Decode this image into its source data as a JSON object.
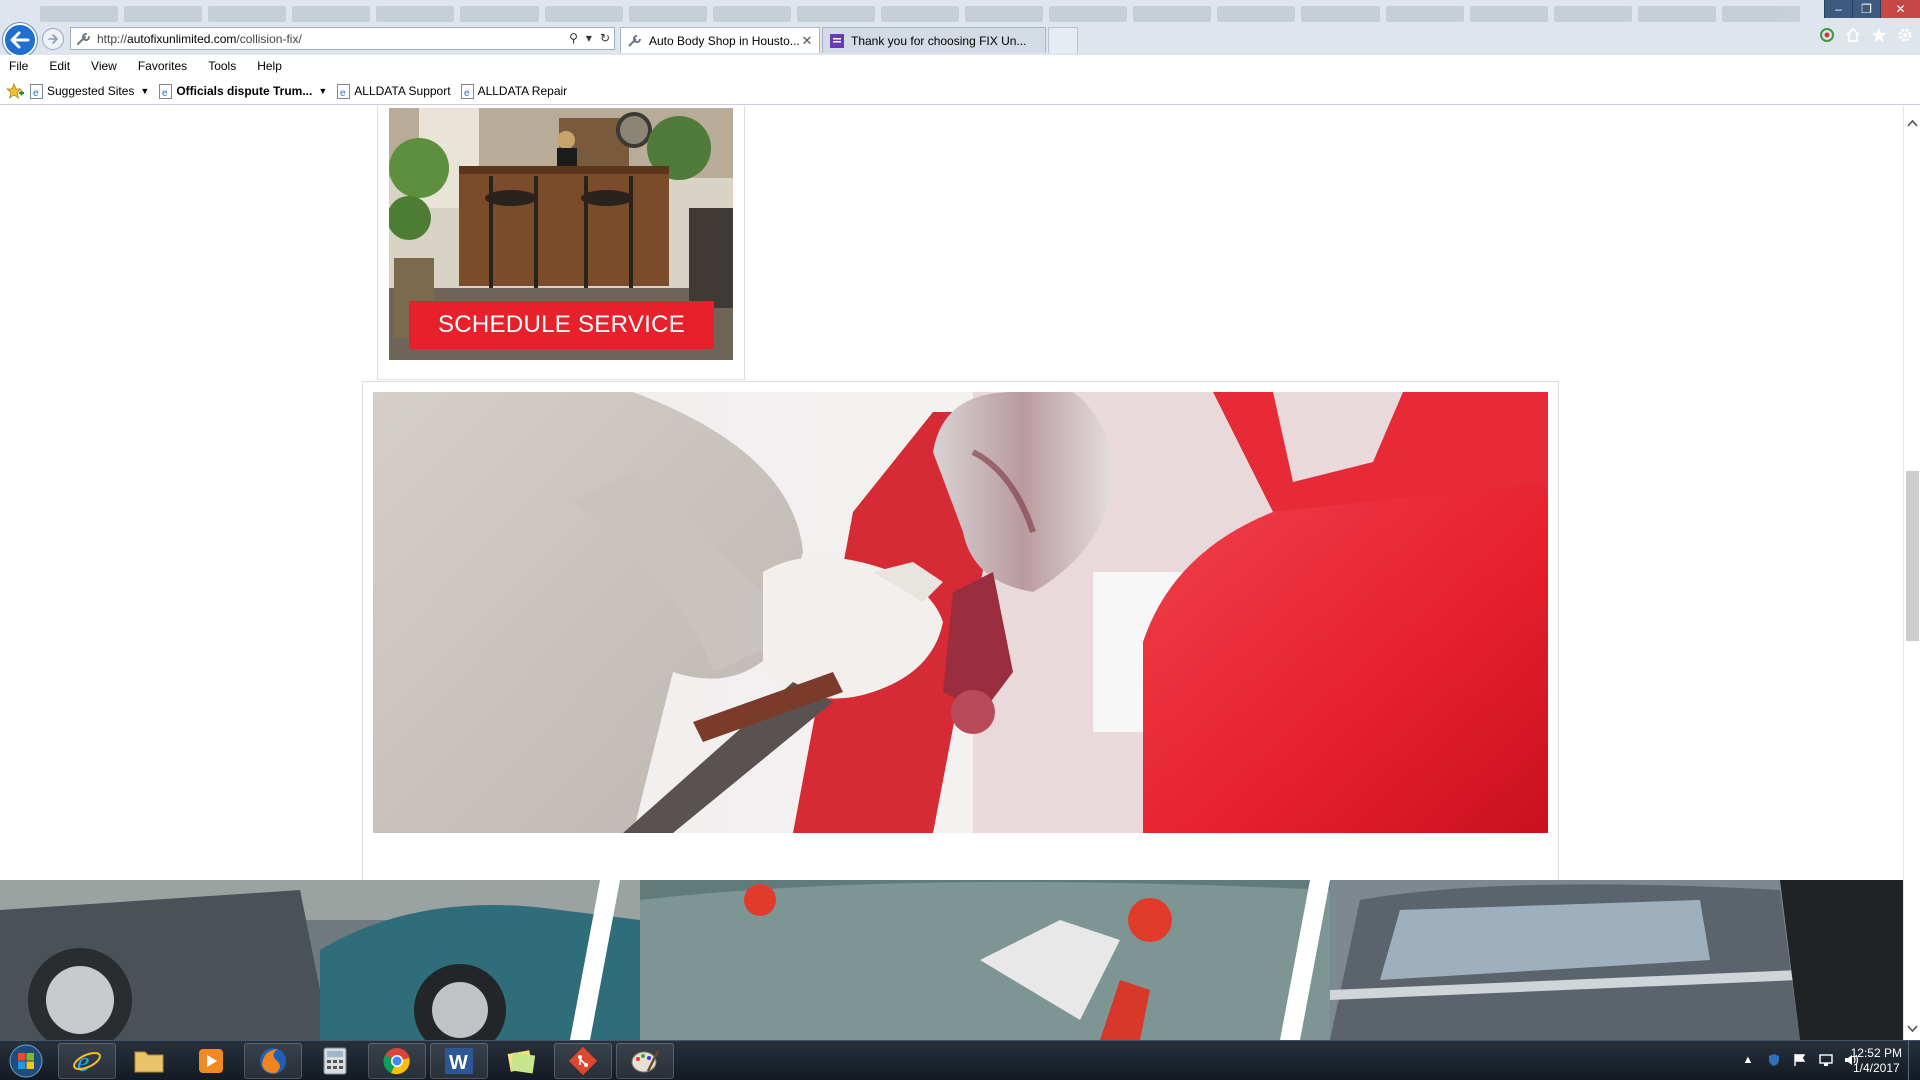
{
  "browser": {
    "url_prefix": "http://",
    "url_domain": "autofixunlimited.com",
    "url_path": "/collision-fix/",
    "tabs": [
      {
        "label": "Auto Body Shop in Housto..."
      },
      {
        "label": "Thank you for choosing FIX Un..."
      }
    ],
    "menu": [
      "File",
      "Edit",
      "View",
      "Favorites",
      "Tools",
      "Help"
    ],
    "favorites": [
      {
        "label": "Suggested Sites"
      },
      {
        "label": "Officials dispute Trum..."
      },
      {
        "label": "ALLDATA Support"
      },
      {
        "label": "ALLDATA Repair"
      }
    ]
  },
  "page": {
    "schedule_button": "SCHEDULE SERVICE"
  },
  "taskbar": {
    "time": "12:52 PM",
    "date": "1/4/2017",
    "apps": [
      "internet-explorer",
      "file-explorer",
      "media-player",
      "firefox",
      "calculator",
      "chrome",
      "word",
      "sticky-notes",
      "git",
      "paint"
    ]
  },
  "colors": {
    "brand_red": "#e8202c",
    "ie_blue": "#1e6fcf"
  }
}
